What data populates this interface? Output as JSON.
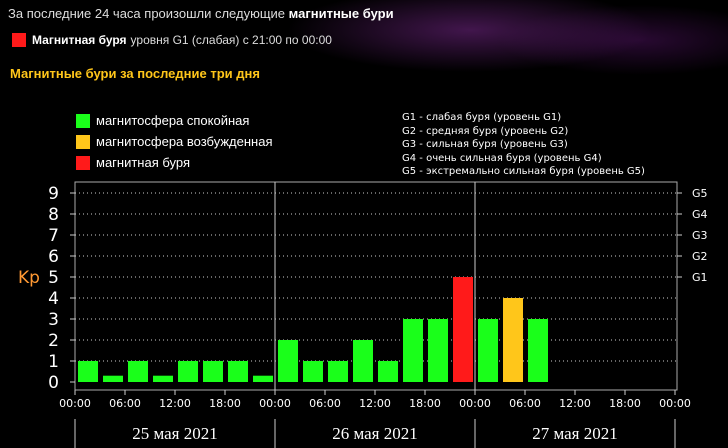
{
  "header": {
    "line_prefix": "За последние 24 часа произошли следующие",
    "line_bold": "магнитные бури",
    "storm_label": "Магнитная буря",
    "storm_text": "уровня G1 (слабая) с 21:00 по 00:00",
    "storm_color": "#ff1a1a",
    "subheading": "Магнитные бури за последние три дня"
  },
  "legend": [
    {
      "label": "магнитосфера спокойная",
      "color": "#1aff1a"
    },
    {
      "label": "магнитосфера возбужденная",
      "color": "#ffc61a"
    },
    {
      "label": "магнитная буря",
      "color": "#ff1a1a"
    }
  ],
  "levels": [
    "G1 - слабая буря (уровень G1)",
    "G2 - средняя буря (уровень G2)",
    "G3 - сильная буря (уровень G3)",
    "G4 - очень сильная буря (уровень G4)",
    "G5 - экстремально сильная буря (уровень G5)"
  ],
  "chart_data": {
    "type": "bar",
    "ylabel": "Kp",
    "ylim": [
      0,
      9
    ],
    "yticks": [
      "0",
      "1",
      "2",
      "3",
      "4",
      "5",
      "6",
      "7",
      "8",
      "9"
    ],
    "right_ticks": [
      {
        "label": "G1",
        "y": 5
      },
      {
        "label": "G2",
        "y": 6
      },
      {
        "label": "G3",
        "y": 7
      },
      {
        "label": "G4",
        "y": 8
      },
      {
        "label": "G5",
        "y": 9
      }
    ],
    "x_labels": [
      "00:00",
      "06:00",
      "12:00",
      "18:00",
      "00:00",
      "06:00",
      "12:00",
      "18:00",
      "00:00",
      "06:00",
      "12:00",
      "18:00",
      "00:00"
    ],
    "days": [
      "25 мая 2021",
      "26 мая 2021",
      "27 мая 2021"
    ],
    "grid": true,
    "colors": {
      "quiet": "#1aff1a",
      "active": "#ffc61a",
      "storm": "#ff1a1a"
    },
    "values": [
      1,
      0.3,
      1,
      0.3,
      1,
      1,
      1,
      0.3,
      2,
      1,
      1,
      2,
      1,
      3,
      3,
      5,
      3,
      4,
      3
    ],
    "status": [
      "quiet",
      "quiet",
      "quiet",
      "quiet",
      "quiet",
      "quiet",
      "quiet",
      "quiet",
      "quiet",
      "quiet",
      "quiet",
      "quiet",
      "quiet",
      "quiet",
      "quiet",
      "storm",
      "quiet",
      "active",
      "quiet"
    ]
  }
}
